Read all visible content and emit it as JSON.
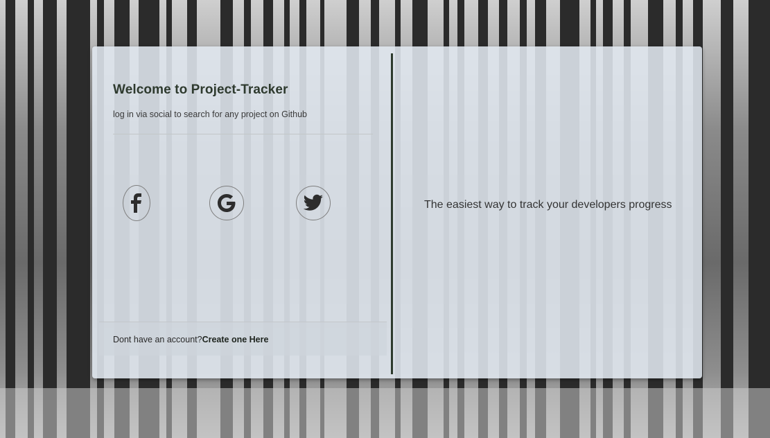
{
  "welcome": {
    "title": "Welcome to Project-Tracker",
    "subtitle": "log in via social to search for any project on Github"
  },
  "social": [
    {
      "name": "facebook",
      "icon": "facebook-icon"
    },
    {
      "name": "google",
      "icon": "google-icon"
    },
    {
      "name": "twitter",
      "icon": "twitter-icon"
    }
  ],
  "footer": {
    "prompt": "Dont have an account?",
    "link": "Create one Here"
  },
  "tagline": "The easiest way to track your developers progress",
  "colors": {
    "card_bg": "#e1e8f0",
    "divider": "#2d3a2d",
    "title": "#2e3a2e"
  }
}
